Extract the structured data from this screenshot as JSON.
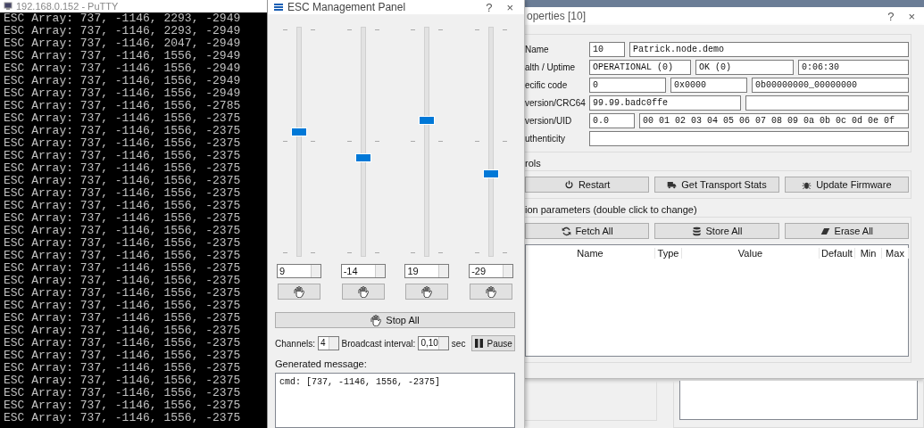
{
  "terminal": {
    "title": "192.168.0.152 - PuTTY",
    "lines": [
      "ESC Array: 737, -1146, 2293, -2949",
      "ESC Array: 737, -1146, 2293, -2949",
      "ESC Array: 737, -1146, 2047, -2949",
      "ESC Array: 737, -1146, 1556, -2949",
      "ESC Array: 737, -1146, 1556, -2949",
      "ESC Array: 737, -1146, 1556, -2949",
      "ESC Array: 737, -1146, 1556, -2949",
      "ESC Array: 737, -1146, 1556, -2785",
      "ESC Array: 737, -1146, 1556, -2375",
      "ESC Array: 737, -1146, 1556, -2375",
      "ESC Array: 737, -1146, 1556, -2375",
      "ESC Array: 737, -1146, 1556, -2375",
      "ESC Array: 737, -1146, 1556, -2375",
      "ESC Array: 737, -1146, 1556, -2375",
      "ESC Array: 737, -1146, 1556, -2375",
      "ESC Array: 737, -1146, 1556, -2375",
      "ESC Array: 737, -1146, 1556, -2375",
      "ESC Array: 737, -1146, 1556, -2375",
      "ESC Array: 737, -1146, 1556, -2375",
      "ESC Array: 737, -1146, 1556, -2375",
      "ESC Array: 737, -1146, 1556, -2375",
      "ESC Array: 737, -1146, 1556, -2375",
      "ESC Array: 737, -1146, 1556, -2375",
      "ESC Array: 737, -1146, 1556, -2375",
      "ESC Array: 737, -1146, 1556, -2375",
      "ESC Array: 737, -1146, 1556, -2375",
      "ESC Array: 737, -1146, 1556, -2375",
      "ESC Array: 737, -1146, 1556, -2375",
      "ESC Array: 737, -1146, 1556, -2375",
      "ESC Array: 737, -1146, 1556, -2375",
      "ESC Array: 737, -1146, 1556, -2375",
      "ESC Array: 737, -1146, 1556, -2375",
      "ESC Array: 737, -1146, 1556, -2375"
    ]
  },
  "esc_panel": {
    "title": "ESC Management Panel",
    "help": "?",
    "close": "×",
    "channels": [
      {
        "value": "9",
        "level": 0.545
      },
      {
        "value": "-14",
        "level": 0.43
      },
      {
        "value": "19",
        "level": 0.595
      },
      {
        "value": "-29",
        "level": 0.355
      }
    ],
    "stop_all": "Stop All",
    "channels_label": "Channels:",
    "channels_value": "4",
    "interval_label": "Broadcast interval:",
    "interval_value": "0,10",
    "interval_unit": "sec",
    "pause": "Pause",
    "message_label": "Generated message:",
    "message": "cmd: [737, -1146, 1556, -2375]"
  },
  "properties": {
    "title": "operties [10]",
    "help": "?",
    "close": "×",
    "fields": [
      {
        "label": "Name",
        "values": [
          {
            "value": "10"
          },
          {
            "value": "Patrick.node.demo"
          }
        ]
      },
      {
        "label": "alth / Uptime",
        "values": [
          {
            "value": "OPERATIONAL (0)"
          },
          {
            "value": "OK (0)"
          },
          {
            "value": "0:06:30"
          }
        ]
      },
      {
        "label": "ecific code",
        "values": [
          {
            "value": "0"
          },
          {
            "value": "0x0000"
          },
          {
            "value": "0b00000000_00000000"
          }
        ]
      },
      {
        "label": "version/CRC64",
        "values": [
          {
            "kind": "text",
            "value": "99.99.badc0ffe"
          },
          {
            "kind": "blank"
          }
        ]
      },
      {
        "label": "version/UID",
        "values": [
          {
            "value": "0.0"
          },
          {
            "value": "00 01 02 03 04 05 06 07 08 09 0a 0b 0c 0d 0e 0f"
          }
        ]
      },
      {
        "label": "uthenticity",
        "values": [
          {
            "kind": "blank"
          }
        ]
      }
    ],
    "controls": {
      "title": "rols",
      "buttons": [
        {
          "label": "Restart",
          "kind": "power"
        },
        {
          "label": "Get Transport Stats",
          "kind": "truck"
        },
        {
          "label": "Update Firmware",
          "kind": "bug"
        }
      ]
    },
    "parameters": {
      "title": "ion parameters (double click to change)",
      "buttons": [
        {
          "label": "Fetch All",
          "kind": "refresh"
        },
        {
          "label": "Store All",
          "kind": "database"
        },
        {
          "label": "Erase All",
          "kind": "eraser"
        }
      ],
      "columns": [
        "Name",
        "Type",
        "Value",
        "Default",
        "Min",
        "Max"
      ]
    }
  }
}
